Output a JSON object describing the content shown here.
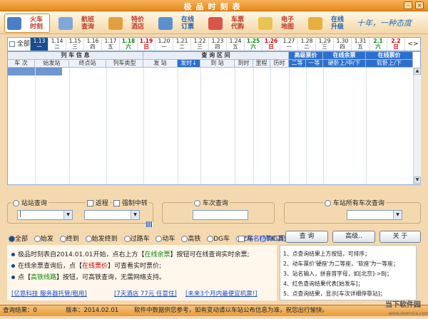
{
  "window": {
    "title": "极品时刻表",
    "min_icon": "minimize-icon",
    "close_icon": "close-icon"
  },
  "toolbar": {
    "items": [
      {
        "label": "火车\n时刻",
        "icon": "train-icon",
        "color": "#c0392b"
      },
      {
        "label": "航班\n查询",
        "icon": "airplane-icon",
        "color": "#c0392b"
      },
      {
        "label": "特价\n酒店",
        "icon": "hotel-icon",
        "color": "#c0392b"
      },
      {
        "label": "在线\n订票",
        "icon": "ticket-icon",
        "color": "#1f5fb0"
      },
      {
        "label": "车票\n代购",
        "icon": "cart-icon",
        "color": "#c0392b"
      },
      {
        "label": "电子\n地图",
        "icon": "map-icon",
        "color": "#c0392b"
      },
      {
        "label": "在线\n升级",
        "icon": "upgrade-icon",
        "color": "#1f5fb0"
      }
    ],
    "slogan": "十年，一种态度"
  },
  "datebar": {
    "all_label": "全部",
    "dates": [
      {
        "d": "1.13",
        "w": "一",
        "style": "sel"
      },
      {
        "d": "1.14",
        "w": "二",
        "style": ""
      },
      {
        "d": "1.15",
        "w": "三",
        "style": ""
      },
      {
        "d": "1.16",
        "w": "四",
        "style": ""
      },
      {
        "d": "1.17",
        "w": "五",
        "style": ""
      },
      {
        "d": "1.18",
        "w": "六",
        "style": "green"
      },
      {
        "d": "1.19",
        "w": "日",
        "style": "red"
      },
      {
        "d": "1.20",
        "w": "一",
        "style": ""
      },
      {
        "d": "1.21",
        "w": "二",
        "style": ""
      },
      {
        "d": "1.22",
        "w": "三",
        "style": ""
      },
      {
        "d": "1.23",
        "w": "四",
        "style": ""
      },
      {
        "d": "1.24",
        "w": "五",
        "style": ""
      },
      {
        "d": "1.25",
        "w": "六",
        "style": "green"
      },
      {
        "d": "1.26",
        "w": "日",
        "style": "red"
      },
      {
        "d": "1.27",
        "w": "一",
        "style": ""
      },
      {
        "d": "1.28",
        "w": "二",
        "style": ""
      },
      {
        "d": "1.29",
        "w": "三",
        "style": ""
      },
      {
        "d": "1.30",
        "w": "四",
        "style": ""
      },
      {
        "d": "1.31",
        "w": "五",
        "style": ""
      },
      {
        "d": "2.1",
        "w": "六",
        "style": "green"
      },
      {
        "d": "2.2",
        "w": "日",
        "style": "red"
      }
    ],
    "arrows": "<>"
  },
  "table": {
    "group_headers": {
      "train_info": "列 车 信 息",
      "query_range": "查 询 区 间",
      "hs_price": "高级票价",
      "ws_online": "在线余票",
      "ws_price": "在线票价"
    },
    "columns": [
      "车  次",
      "始发站",
      "终点站",
      "列车类型",
      "发  站",
      "发时↓",
      "到  站",
      "到时",
      "里程",
      "历时",
      "二等",
      "一等",
      "硬卧上/中/下",
      "软卧上/下"
    ]
  },
  "query": {
    "station_radio": "站站查询",
    "return_label": "返程",
    "transfer_label": "强制中转",
    "train_radio": "车次查询",
    "all_trains_radio": "车站所有车次查询",
    "from_value": "|",
    "filters": [
      "全部",
      "始发",
      "终到",
      "始发终到",
      "过路车",
      "动车",
      "高铁",
      "DG车",
      "Z车",
      "T.K.其余车"
    ],
    "exact_match": "站名精确匹配",
    "btn_query": "查  询",
    "btn_advanced": "高级..",
    "btn_about": "关  于"
  },
  "info": {
    "line1_a": "极品时刻表自2014.01.01开始，点右上方【",
    "line1_b": "在线余票",
    "line1_c": "】按钮可在线查询实时余票;",
    "line2_a": "在线余票查询后，点【",
    "line2_b": "在线票价",
    "line2_c": "】可查看实时票价;",
    "line3_a": "点【",
    "line3_b": "高铁线路",
    "line3_c": "】按钮，可高铁查询，无需网络支持。",
    "links": [
      "[亿恩科技 服务器托管/租用]",
      "[7天酒店 77元 任意住]",
      "[未来3个月内最便宜机票!]"
    ],
    "tips": [
      "1、点查询结果上方按钮，可排序；",
      "2、动车票价'硬座'为二等座，'软座'为一等座；",
      "3、站名输入，拼音首字母，如[北京]->BJ；",
      "4、红色查询结果代表[始发车]；",
      "5、点查询结果，显示[车次详细停靠站]；"
    ]
  },
  "statusbar": {
    "result": "查询结果：0",
    "version": "版本：2014.02.01",
    "disclaimer": "软件中数据供您参考，如有变动请以车站公布信息为准，祝您出行愉快。",
    "watermark": "当下软件园",
    "watermark_url": "www.downxia.com"
  },
  "colors": {
    "accent": "#e58a1a",
    "header_blue": "#2b6fd0",
    "selected_date": "#1a4d8f"
  }
}
